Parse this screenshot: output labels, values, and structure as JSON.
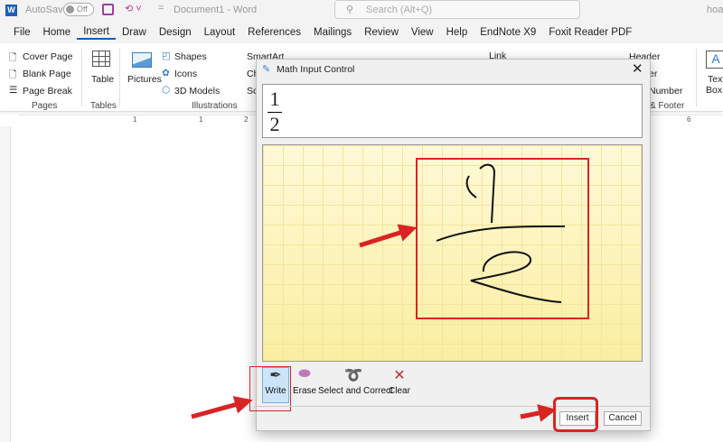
{
  "titlebar": {
    "autosave": "AutoSave",
    "toggle": "Off",
    "doc_title": "Document1 - Word",
    "search_placeholder": "Search (Alt+Q)",
    "user": "hoa"
  },
  "tabs": [
    "File",
    "Home",
    "Insert",
    "Draw",
    "Design",
    "Layout",
    "References",
    "Mailings",
    "Review",
    "View",
    "Help",
    "EndNote X9",
    "Foxit Reader PDF"
  ],
  "active_tab": "Insert",
  "ribbon": {
    "pages": {
      "items": [
        "Cover Page",
        "Blank Page",
        "Page Break"
      ],
      "label": "Pages"
    },
    "tables": {
      "item": "Table",
      "label": "Tables"
    },
    "illustrations": {
      "pictures": "Pictures",
      "items": [
        "Shapes",
        "Icons",
        "3D Models"
      ],
      "smartart": "SmartArt",
      "chart": "Ch",
      "screenshot": "Sc",
      "label": "Illustrations"
    },
    "link": "Link",
    "header_footer": {
      "header": "Header",
      "footer": "er",
      "page_number": "Number",
      "label": "& Footer"
    },
    "textbox": {
      "line1": "Text",
      "line2": "Box"
    }
  },
  "ruler": [
    "1",
    "1",
    "2",
    "6"
  ],
  "dialog": {
    "title": "Math Input Control",
    "preview": {
      "numerator": "1",
      "denominator": "2"
    },
    "tools": [
      {
        "label": "Write",
        "icon": "pen-icon",
        "selected": true
      },
      {
        "label": "Erase",
        "icon": "eraser-icon"
      },
      {
        "label": "Select and Correct",
        "icon": "lasso-icon"
      },
      {
        "label": "Clear",
        "icon": "clear-x-icon"
      }
    ],
    "insert": "Insert",
    "cancel": "Cancel"
  },
  "colors": {
    "annotation": "#d92424",
    "accent": "#185abd",
    "pad": "#fdf6c0"
  }
}
